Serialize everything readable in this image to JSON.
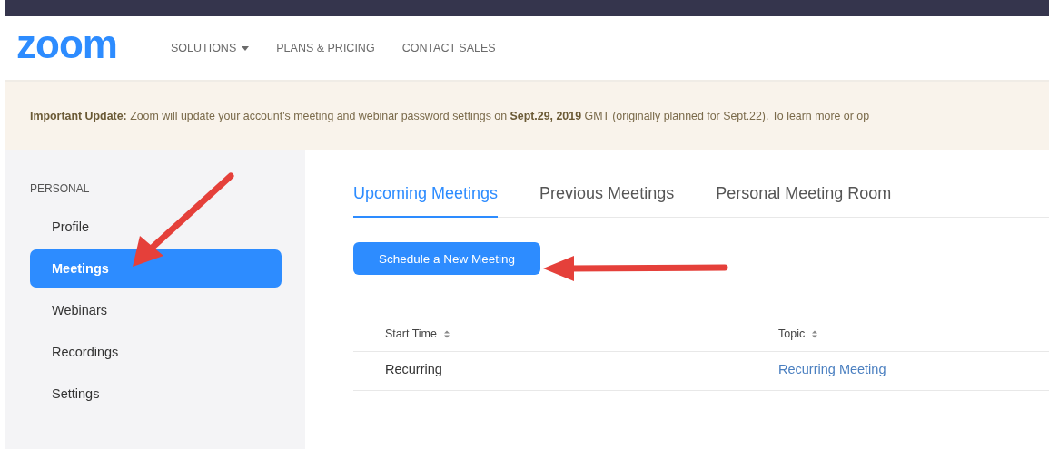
{
  "header": {
    "logo": "zoom",
    "nav": [
      {
        "label": "SOLUTIONS",
        "dropdown": true
      },
      {
        "label": "PLANS & PRICING",
        "dropdown": false
      },
      {
        "label": "CONTACT SALES",
        "dropdown": false
      }
    ]
  },
  "banner": {
    "text": "**Important Update:** Zoom will update your account's meeting and webinar password settings on **Sept.29, 2019** GMT (originally planned for Sept.22). To learn more or op"
  },
  "sidebar": {
    "section": "PERSONAL",
    "items": [
      {
        "label": "Profile",
        "selected": false
      },
      {
        "label": "Meetings",
        "selected": true
      },
      {
        "label": "Webinars",
        "selected": false
      },
      {
        "label": "Recordings",
        "selected": false
      },
      {
        "label": "Settings",
        "selected": false
      }
    ]
  },
  "tabs": [
    {
      "label": "Upcoming Meetings",
      "selected": true
    },
    {
      "label": "Previous Meetings",
      "selected": false
    },
    {
      "label": "Personal Meeting Room",
      "selected": false
    }
  ],
  "schedule_button": "Schedule a New Meeting",
  "table": {
    "columns": [
      "Start Time",
      "Topic"
    ],
    "rows": [
      {
        "start_time": "Recurring",
        "topic": "Recurring Meeting"
      }
    ]
  }
}
